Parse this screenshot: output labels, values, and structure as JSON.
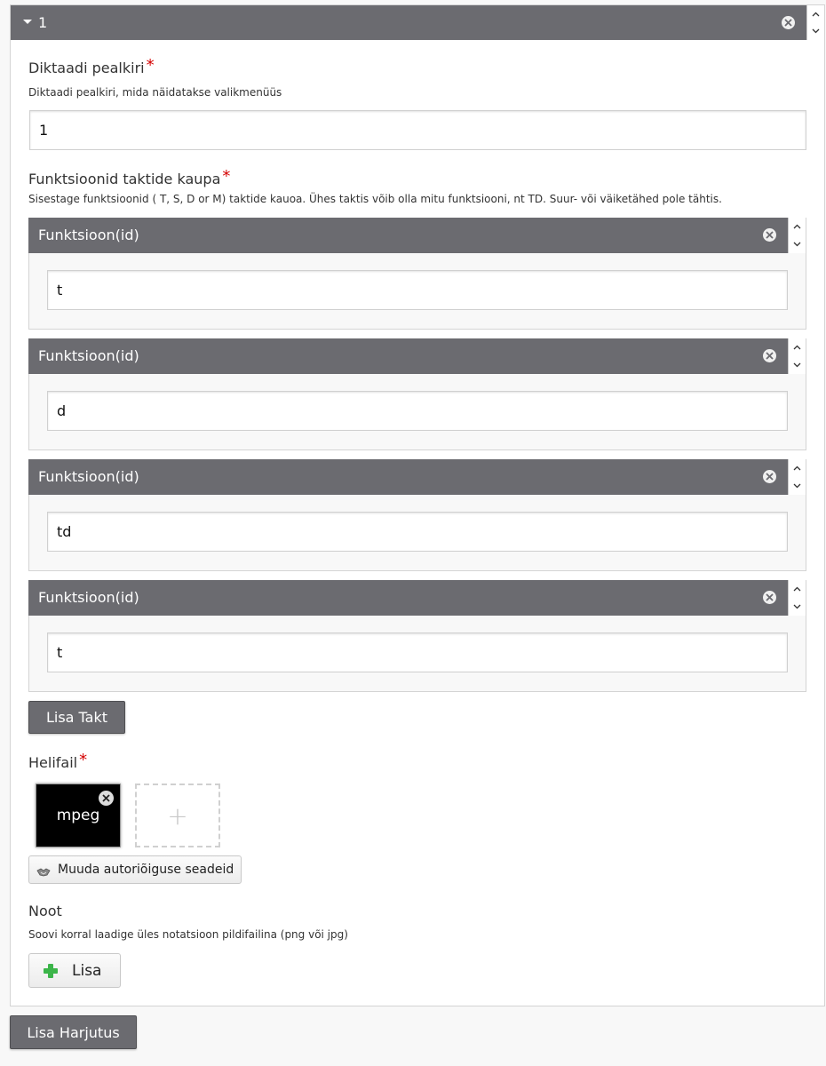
{
  "item": {
    "title": "1"
  },
  "title_field": {
    "label": "Diktaadi pealkiri",
    "required_mark": "*",
    "description": "Diktaadi pealkiri, mida näidatakse valikmenüüs",
    "value": "1"
  },
  "functions_field": {
    "label": "Funktsioonid taktide kaupa",
    "required_mark": "*",
    "description": "Sisestage funktsioonid ( T, S, D or M) taktide kauoa. Ühes taktis võib olla mitu funktsiooni, nt TD. Suur- või väiketähed pole tähtis.",
    "items": [
      {
        "title": "Funktsioon(id)",
        "value": "t"
      },
      {
        "title": "Funktsioon(id)",
        "value": "d"
      },
      {
        "title": "Funktsioon(id)",
        "value": "td"
      },
      {
        "title": "Funktsioon(id)",
        "value": "t"
      }
    ],
    "add_button": "Lisa Takt"
  },
  "audio_field": {
    "label": "Helifail",
    "required_mark": "*",
    "file_label": "mpeg",
    "add_placeholder": "+",
    "copyright_button": "Muuda autoriõiguse seadeid"
  },
  "note_field": {
    "label": "Noot",
    "description": "Soovi korral laadige üles notatsioon pildifailina (png või jpg)",
    "add_button": "Lisa"
  },
  "add_exercise_button": "Lisa Harjutus",
  "colors": {
    "bar": "#6b6b70",
    "required": "#d40000",
    "add_icon": "#3cb54a"
  }
}
